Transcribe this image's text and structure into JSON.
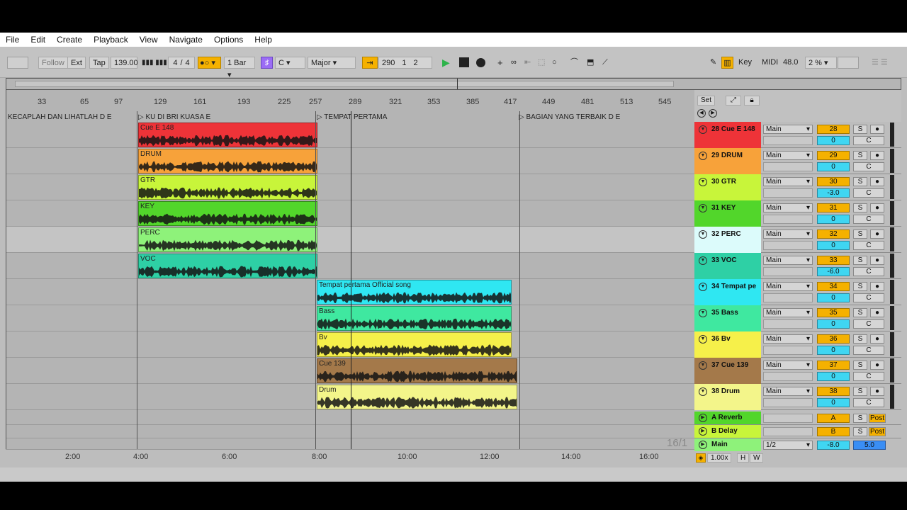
{
  "menu": [
    "File",
    "Edit",
    "Create",
    "Playback",
    "View",
    "Navigate",
    "Options",
    "Help"
  ],
  "control": {
    "follow": "Follow",
    "ext": "Ext",
    "tap": "Tap",
    "tempo": "139.00",
    "sig_num": "4",
    "sig_sep": "/",
    "sig_den": "4",
    "quant": "1 Bar",
    "key": "C",
    "scale": "Major",
    "pos_bar": "290",
    "pos_beat": "1",
    "pos_sixteenth": "2",
    "key_btn": "Key",
    "midi_btn": "MIDI",
    "cpu": "48.0",
    "zoom": "2 %"
  },
  "ruler": [
    "33",
    "65",
    "97",
    "129",
    "161",
    "193",
    "225",
    "257",
    "289",
    "321",
    "353",
    "385",
    "417",
    "449",
    "481",
    "513",
    "545"
  ],
  "locators": [
    {
      "label": "KECAPLAH DAN LIHATLAH D E",
      "marker": false
    },
    {
      "label": "KU DI BRI KUASA E",
      "marker": true
    },
    {
      "label": "TEMPAT PERTAMA",
      "marker": true
    },
    {
      "label": "BAGIAN YANG TERBAIK D E",
      "marker": true
    }
  ],
  "clips": [
    {
      "name": "Cue E 148",
      "color": "#ee3338",
      "lane": 0
    },
    {
      "name": "DRUM",
      "color": "#f7a23a",
      "lane": 1
    },
    {
      "name": "GTR",
      "color": "#c8f53a",
      "lane": 2
    },
    {
      "name": "KEY",
      "color": "#52d62b",
      "lane": 3
    },
    {
      "name": "PERC",
      "color": "#8ef27a",
      "lane": 4
    },
    {
      "name": "VOC",
      "color": "#2ed0a5",
      "lane": 5
    },
    {
      "name": "Tempat pertama Official song",
      "color": "#2fe7f2",
      "lane": 6
    },
    {
      "name": "Bass",
      "color": "#3fe8a0",
      "lane": 7
    },
    {
      "name": "Bv",
      "color": "#f6f04a",
      "lane": 8
    },
    {
      "name": "Cue 139",
      "color": "#a4794a",
      "lane": 9
    },
    {
      "name": "Drum",
      "color": "#f3f58a",
      "lane": 10
    }
  ],
  "set_btn": "Set",
  "tracks": [
    {
      "name": "28 Cue E 148",
      "color": "#ee3338",
      "route": "Main",
      "num": "28",
      "vol": "0",
      "pan": "C"
    },
    {
      "name": "29 DRUM",
      "color": "#f7a23a",
      "route": "Main",
      "num": "29",
      "vol": "0",
      "pan": "C"
    },
    {
      "name": "30 GTR",
      "color": "#c8f53a",
      "route": "Main",
      "num": "30",
      "vol": "-3.0",
      "pan": "C"
    },
    {
      "name": "31 KEY",
      "color": "#52d62b",
      "route": "Main",
      "num": "31",
      "vol": "0",
      "pan": "C"
    },
    {
      "name": "32 PERC",
      "color": "#dcfbfb",
      "route": "Main",
      "num": "32",
      "vol": "0",
      "pan": "C"
    },
    {
      "name": "33 VOC",
      "color": "#2ed0a5",
      "route": "Main",
      "num": "33",
      "vol": "-6.0",
      "pan": "C"
    },
    {
      "name": "34 Tempat pe",
      "color": "#2fe7f2",
      "route": "Main",
      "num": "34",
      "vol": "0",
      "pan": "C"
    },
    {
      "name": "35 Bass",
      "color": "#3fe8a0",
      "route": "Main",
      "num": "35",
      "vol": "0",
      "pan": "C"
    },
    {
      "name": "36 Bv",
      "color": "#f6f04a",
      "route": "Main",
      "num": "36",
      "vol": "0",
      "pan": "C"
    },
    {
      "name": "37 Cue 139",
      "color": "#a4794a",
      "route": "Main",
      "num": "37",
      "vol": "0",
      "pan": "C"
    },
    {
      "name": "38 Drum",
      "color": "#f3f58a",
      "route": "Main",
      "num": "38",
      "vol": "0",
      "pan": "C"
    }
  ],
  "returns": [
    {
      "name": "A Reverb",
      "color": "#52d62b",
      "num": "A",
      "post": "Post"
    },
    {
      "name": "B Delay",
      "color": "#c8f53a",
      "num": "B",
      "post": "Post"
    }
  ],
  "main": {
    "name": "Main",
    "color": "#8ef27a",
    "route": "1/2",
    "vol": "-8.0",
    "val2": "5.0"
  },
  "timeline": [
    "2:00",
    "4:00",
    "6:00",
    "8:00",
    "10:00",
    "12:00",
    "14:00",
    "16:00"
  ],
  "zoom_readout": "1.00x",
  "h_btn": "H",
  "w_btn": "W",
  "grid_readout": "16/1",
  "solo_label": "S",
  "pan_center": "C"
}
